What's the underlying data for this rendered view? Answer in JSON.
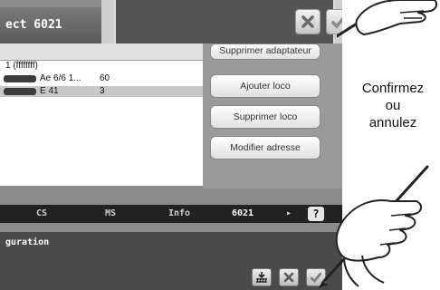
{
  "title": "ect 6021",
  "list": {
    "group_row": "1 (ffffffff)",
    "rows": [
      {
        "name": "Ae 6/6 1...",
        "address": "60",
        "selected": false
      },
      {
        "name": "E 41",
        "address": "3",
        "selected": true
      }
    ]
  },
  "side_buttons": {
    "truncated_top": "Supprimer adaptateur",
    "add": "Ajouter loco",
    "remove": "Supprimer loco",
    "modify": "Modifier adresse"
  },
  "tabs": [
    "CS",
    "MS",
    "Info",
    "6021"
  ],
  "help": "?",
  "bottom_label": "guration",
  "instruction": {
    "line1": "Confirmez",
    "line2": "ou",
    "line3": "annulez"
  },
  "icons": {
    "cancel": "x-icon",
    "confirm": "check-icon",
    "track": "track-icon",
    "hand": "hand-pen-icon"
  }
}
